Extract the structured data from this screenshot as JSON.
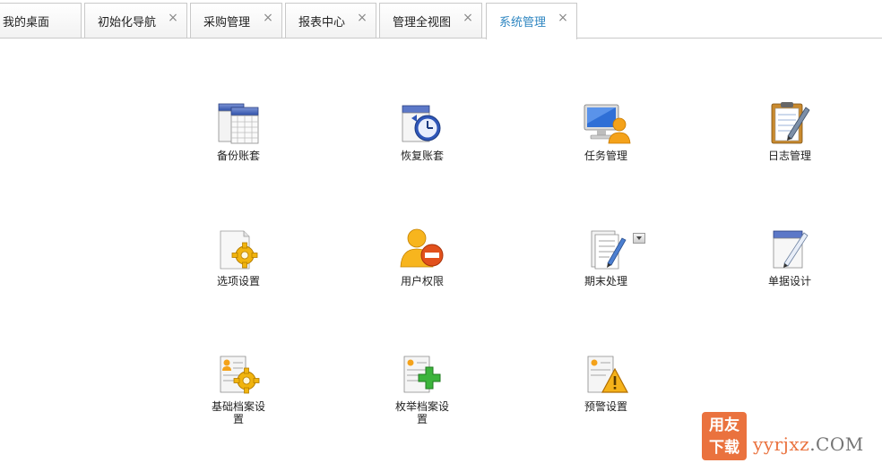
{
  "tabs": [
    {
      "label": "我的桌面",
      "closable": false,
      "active": false
    },
    {
      "label": "初始化导航",
      "closable": true,
      "active": false
    },
    {
      "label": "采购管理",
      "closable": true,
      "active": false
    },
    {
      "label": "报表中心",
      "closable": true,
      "active": false
    },
    {
      "label": "管理全视图",
      "closable": true,
      "active": false
    },
    {
      "label": "系统管理",
      "closable": true,
      "active": true
    }
  ],
  "close_glyph": "×",
  "items": [
    {
      "label": "备份账套",
      "icon": "backup-account-icon"
    },
    {
      "label": "恢复账套",
      "icon": "restore-account-icon"
    },
    {
      "label": "任务管理",
      "icon": "task-management-icon"
    },
    {
      "label": "日志管理",
      "icon": "log-management-icon"
    },
    {
      "label": "选项设置",
      "icon": "options-settings-icon"
    },
    {
      "label": "用户权限",
      "icon": "user-permission-icon"
    },
    {
      "label": "期末处理",
      "icon": "period-end-icon"
    },
    {
      "label": "单据设计",
      "icon": "document-design-icon"
    },
    {
      "label": "基础档案设置",
      "icon": "basic-archive-icon"
    },
    {
      "label": "枚举档案设置",
      "icon": "enum-archive-icon"
    },
    {
      "label": "预警设置",
      "icon": "warning-settings-icon"
    }
  ],
  "watermark": {
    "logo_top": "用友",
    "logo_bottom": "下载",
    "site": "yyrjxz",
    "suffix": ".COM"
  },
  "colors": {
    "active_tab_text": "#2e86c1",
    "watermark": "#e8632a"
  }
}
